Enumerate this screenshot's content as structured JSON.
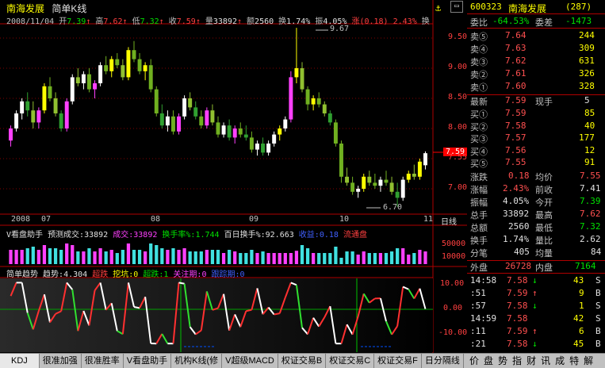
{
  "title": {
    "stock_name": "南海发展",
    "mode": "简单K线"
  },
  "info_bar": {
    "date": "2008/11/04",
    "open_label": "开",
    "open": "7.39",
    "high_label": "高",
    "high": "7.62",
    "low_label": "低",
    "low": "7.32",
    "close_label": "收",
    "close": "7.59",
    "vol_label": "量",
    "vol": "33892",
    "amt_label": "额",
    "amt": "2560",
    "turn_label": "换",
    "turn": "1.74%",
    "amp_label": "振",
    "amp": "4.05%",
    "chg_label": "涨",
    "chg": "(0.18)",
    "chg_pct": "2.43%",
    "trail": "换"
  },
  "price_axis": [
    "9.50",
    "9.00",
    "8.50",
    "8.00",
    "7.55",
    "7.00"
  ],
  "annotations": {
    "max": "9.67",
    "min": "6.70",
    "last_price_tag": "7.59"
  },
  "date_axis": [
    "2008",
    "07",
    "08",
    "09",
    "10",
    "11"
  ],
  "period_label": "日线",
  "volume_bar": {
    "name": "V看盘助手",
    "predict_label": "预测成交:",
    "predict": "33892",
    "cj_label": "成交:",
    "cj": "33892",
    "hs_label": "换手率%:",
    "hs": "1.744",
    "bh_label": "百日换手%:",
    "bh": "92.663",
    "sy_label": "收益:",
    "sy": "0.18",
    "ltp_label": "流通盘"
  },
  "volume_axis": [
    "50000",
    "10000"
  ],
  "trend_bar": {
    "name": "简单趋势",
    "trend_label": "趋势:",
    "trend": "4.304",
    "oversold": "超跌",
    "dig": "挖坑:",
    "dig_v": "0",
    "super": "超跌:",
    "super_v": "1",
    "watch": "关注期:",
    "watch_v": "0",
    "follow": "跟踪期:",
    "follow_v": "0"
  },
  "trend_axis": [
    "10.00",
    "0.00",
    "-10.00"
  ],
  "tabs": [
    "KDJ",
    "很准加强",
    "很准胜率",
    "V看盘助手",
    "机构K线(修",
    "V超级MACD",
    "权证交易B",
    "权证交易C",
    "权证交易F",
    "日分隔线"
  ],
  "right_panel": {
    "code": "600323",
    "name": "南海发展",
    "num": "(287)",
    "wb_label": "委比",
    "wb": "-64.53%",
    "wc_label": "委差",
    "wc": "-1473",
    "sells": [
      {
        "label": "卖⑤",
        "price": "7.64",
        "vol": "244"
      },
      {
        "label": "卖④",
        "price": "7.63",
        "vol": "309"
      },
      {
        "label": "卖③",
        "price": "7.62",
        "vol": "631"
      },
      {
        "label": "卖②",
        "price": "7.61",
        "vol": "326"
      },
      {
        "label": "卖①",
        "price": "7.60",
        "vol": "328"
      }
    ],
    "latest_label": "最新",
    "latest": "7.59",
    "now_hand_label": "现手",
    "now_hand": "5",
    "buys": [
      {
        "label": "买①",
        "price": "7.59",
        "vol": "85"
      },
      {
        "label": "买②",
        "price": "7.58",
        "vol": "40"
      },
      {
        "label": "买③",
        "price": "7.57",
        "vol": "177"
      },
      {
        "label": "买④",
        "price": "7.56",
        "vol": "12"
      },
      {
        "label": "买⑤",
        "price": "7.55",
        "vol": "91"
      }
    ],
    "stats": [
      {
        "l1": "涨跌",
        "v1": "0.18",
        "l2": "均价",
        "v2": "7.55",
        "c1": "#ff5050",
        "c2": "#ff5050"
      },
      {
        "l1": "涨幅",
        "v1": "2.43%",
        "l2": "前收",
        "v2": "7.41",
        "c1": "#ff5050",
        "c2": "#e0e0e0"
      },
      {
        "l1": "振幅",
        "v1": "4.05%",
        "l2": "今开",
        "v2": "7.39",
        "c1": "#e0e0e0",
        "c2": "#00e000"
      },
      {
        "l1": "总手",
        "v1": "33892",
        "l2": "最高",
        "v2": "7.62",
        "c1": "#e0e0e0",
        "c2": "#ff5050"
      },
      {
        "l1": "总额",
        "v1": "2560",
        "l2": "最低",
        "v2": "7.32",
        "c1": "#e0e0e0",
        "c2": "#00e000"
      },
      {
        "l1": "换手",
        "v1": "1.74%",
        "l2": "量比",
        "v2": "2.62",
        "c1": "#e0e0e0",
        "c2": "#e0e0e0"
      },
      {
        "l1": "分笔",
        "v1": "405",
        "l2": "均量",
        "v2": "84",
        "c1": "#e0e0e0",
        "c2": "#e0e0e0"
      }
    ],
    "outer_label": "外盘",
    "outer": "26728",
    "inner_label": "内盘",
    "inner": "7164",
    "ticks": [
      {
        "t": "14:58",
        "p": "7.58",
        "a": "↓",
        "v": "43",
        "s": "S"
      },
      {
        "t": ":51",
        "p": "7.59",
        "a": "↑",
        "v": "9",
        "s": "B"
      },
      {
        "t": ":57",
        "p": "7.58",
        "a": "↓",
        "v": "1",
        "s": "S"
      },
      {
        "t": "14:59",
        "p": "7.58",
        "a": "",
        "v": "42",
        "s": "S"
      },
      {
        "t": ":11",
        "p": "7.59",
        "a": "↑",
        "v": "6",
        "s": "B"
      },
      {
        "t": ":21",
        "p": "7.58",
        "a": "↓",
        "v": "45",
        "s": "B"
      }
    ],
    "footer_tabs": [
      "价",
      "盘",
      "势",
      "指",
      "财",
      "讯",
      "成",
      "特",
      "解"
    ]
  },
  "chart_data": {
    "type": "candlestick",
    "description_period": "日线",
    "ylim": [
      6.6,
      9.8
    ],
    "candles": [
      {
        "o": 7.8,
        "h": 8.05,
        "l": 7.7,
        "c": 8.0
      },
      {
        "o": 8.0,
        "h": 8.3,
        "l": 7.95,
        "c": 8.25
      },
      {
        "o": 8.25,
        "h": 8.5,
        "l": 8.15,
        "c": 8.45
      },
      {
        "o": 8.45,
        "h": 8.6,
        "l": 8.2,
        "c": 8.3
      },
      {
        "o": 8.3,
        "h": 8.45,
        "l": 8.0,
        "c": 8.1
      },
      {
        "o": 8.1,
        "h": 8.35,
        "l": 8.0,
        "c": 8.3
      },
      {
        "o": 8.3,
        "h": 8.75,
        "l": 8.25,
        "c": 8.7
      },
      {
        "o": 8.7,
        "h": 8.85,
        "l": 8.45,
        "c": 8.5
      },
      {
        "o": 8.5,
        "h": 8.6,
        "l": 8.2,
        "c": 8.25
      },
      {
        "o": 8.25,
        "h": 8.3,
        "l": 7.95,
        "c": 8.0
      },
      {
        "o": 8.0,
        "h": 8.5,
        "l": 7.95,
        "c": 8.45
      },
      {
        "o": 8.45,
        "h": 8.9,
        "l": 8.4,
        "c": 8.85
      },
      {
        "o": 8.85,
        "h": 9.0,
        "l": 8.7,
        "c": 8.75
      },
      {
        "o": 8.75,
        "h": 8.95,
        "l": 8.65,
        "c": 8.9
      },
      {
        "o": 8.9,
        "h": 9.0,
        "l": 8.6,
        "c": 8.65
      },
      {
        "o": 8.65,
        "h": 8.8,
        "l": 8.5,
        "c": 8.75
      },
      {
        "o": 8.75,
        "h": 9.1,
        "l": 8.7,
        "c": 9.05
      },
      {
        "o": 9.05,
        "h": 9.2,
        "l": 8.9,
        "c": 8.95
      },
      {
        "o": 8.95,
        "h": 9.2,
        "l": 8.85,
        "c": 9.15
      },
      {
        "o": 9.15,
        "h": 9.25,
        "l": 9.0,
        "c": 9.05
      },
      {
        "o": 9.05,
        "h": 9.15,
        "l": 8.8,
        "c": 8.85
      },
      {
        "o": 8.85,
        "h": 9.35,
        "l": 8.8,
        "c": 9.3
      },
      {
        "o": 9.3,
        "h": 9.45,
        "l": 9.1,
        "c": 9.15
      },
      {
        "o": 9.15,
        "h": 9.25,
        "l": 8.9,
        "c": 8.95
      },
      {
        "o": 8.95,
        "h": 9.1,
        "l": 8.8,
        "c": 9.05
      },
      {
        "o": 9.05,
        "h": 9.15,
        "l": 8.6,
        "c": 8.65
      },
      {
        "o": 8.65,
        "h": 8.7,
        "l": 8.2,
        "c": 8.25
      },
      {
        "o": 8.25,
        "h": 8.4,
        "l": 8.0,
        "c": 8.05
      },
      {
        "o": 8.05,
        "h": 8.3,
        "l": 7.95,
        "c": 8.2
      },
      {
        "o": 8.2,
        "h": 8.3,
        "l": 7.9,
        "c": 7.95
      },
      {
        "o": 7.95,
        "h": 8.25,
        "l": 7.9,
        "c": 8.2
      },
      {
        "o": 8.2,
        "h": 8.55,
        "l": 8.15,
        "c": 8.5
      },
      {
        "o": 8.5,
        "h": 8.6,
        "l": 8.3,
        "c": 8.35
      },
      {
        "o": 8.35,
        "h": 8.45,
        "l": 8.15,
        "c": 8.2
      },
      {
        "o": 8.2,
        "h": 8.3,
        "l": 8.0,
        "c": 8.05
      },
      {
        "o": 8.05,
        "h": 8.35,
        "l": 8.0,
        "c": 8.3
      },
      {
        "o": 8.3,
        "h": 8.4,
        "l": 8.05,
        "c": 8.1
      },
      {
        "o": 8.1,
        "h": 8.2,
        "l": 7.85,
        "c": 7.9
      },
      {
        "o": 7.9,
        "h": 8.1,
        "l": 7.85,
        "c": 8.05
      },
      {
        "o": 8.05,
        "h": 8.15,
        "l": 7.8,
        "c": 7.85
      },
      {
        "o": 7.85,
        "h": 8.05,
        "l": 7.75,
        "c": 8.0
      },
      {
        "o": 8.0,
        "h": 8.1,
        "l": 7.85,
        "c": 7.9
      },
      {
        "o": 7.9,
        "h": 8.05,
        "l": 7.8,
        "c": 7.85
      },
      {
        "o": 7.85,
        "h": 7.95,
        "l": 7.6,
        "c": 7.65
      },
      {
        "o": 7.65,
        "h": 7.8,
        "l": 7.55,
        "c": 7.75
      },
      {
        "o": 7.75,
        "h": 7.85,
        "l": 7.55,
        "c": 7.6
      },
      {
        "o": 7.6,
        "h": 7.8,
        "l": 7.55,
        "c": 7.75
      },
      {
        "o": 7.75,
        "h": 7.95,
        "l": 7.7,
        "c": 7.9
      },
      {
        "o": 7.9,
        "h": 8.05,
        "l": 7.8,
        "c": 8.0
      },
      {
        "o": 8.0,
        "h": 8.2,
        "l": 7.95,
        "c": 8.15
      },
      {
        "o": 8.15,
        "h": 8.95,
        "l": 8.1,
        "c": 8.85
      },
      {
        "o": 8.85,
        "h": 9.67,
        "l": 8.75,
        "c": 9.0
      },
      {
        "o": 9.0,
        "h": 9.1,
        "l": 8.6,
        "c": 8.65
      },
      {
        "o": 8.65,
        "h": 8.7,
        "l": 8.3,
        "c": 8.4
      },
      {
        "o": 8.4,
        "h": 8.55,
        "l": 8.3,
        "c": 8.5
      },
      {
        "o": 8.5,
        "h": 8.6,
        "l": 8.35,
        "c": 8.4
      },
      {
        "o": 8.4,
        "h": 8.45,
        "l": 8.2,
        "c": 8.25
      },
      {
        "o": 8.25,
        "h": 8.3,
        "l": 8.05,
        "c": 8.1
      },
      {
        "o": 8.1,
        "h": 8.15,
        "l": 7.7,
        "c": 7.75
      },
      {
        "o": 7.75,
        "h": 7.8,
        "l": 7.1,
        "c": 7.2
      },
      {
        "o": 7.2,
        "h": 7.35,
        "l": 7.05,
        "c": 7.1
      },
      {
        "o": 7.1,
        "h": 7.2,
        "l": 6.9,
        "c": 6.95
      },
      {
        "o": 6.95,
        "h": 7.05,
        "l": 6.85,
        "c": 7.0
      },
      {
        "o": 7.0,
        "h": 7.25,
        "l": 6.95,
        "c": 7.2
      },
      {
        "o": 7.2,
        "h": 7.3,
        "l": 7.05,
        "c": 7.1
      },
      {
        "o": 7.1,
        "h": 7.25,
        "l": 7.0,
        "c": 7.05
      },
      {
        "o": 7.05,
        "h": 7.2,
        "l": 6.95,
        "c": 7.15
      },
      {
        "o": 7.15,
        "h": 7.3,
        "l": 7.05,
        "c": 7.1
      },
      {
        "o": 7.1,
        "h": 7.2,
        "l": 6.9,
        "c": 6.95
      },
      {
        "o": 6.95,
        "h": 7.1,
        "l": 6.7,
        "c": 6.85
      },
      {
        "o": 6.85,
        "h": 7.2,
        "l": 6.8,
        "c": 7.15
      },
      {
        "o": 7.15,
        "h": 7.3,
        "l": 7.1,
        "c": 7.25
      },
      {
        "o": 7.25,
        "h": 7.4,
        "l": 7.15,
        "c": 7.2
      },
      {
        "o": 7.2,
        "h": 7.5,
        "l": 7.15,
        "c": 7.45
      },
      {
        "o": 7.39,
        "h": 7.62,
        "l": 7.32,
        "c": 7.59
      }
    ]
  }
}
